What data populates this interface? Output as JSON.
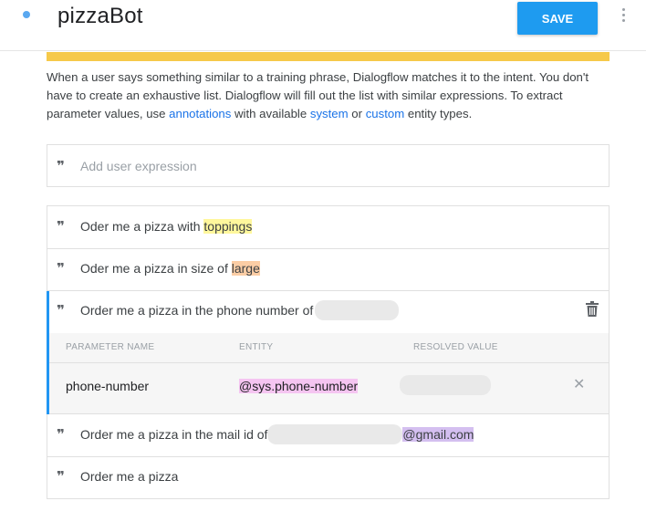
{
  "header": {
    "title": "pizzaBot",
    "save_label": "SAVE"
  },
  "description": {
    "part1": "When a user says something similar to a training phrase, Dialogflow matches it to the intent. You don't have to create an exhaustive list. Dialogflow will fill out the list with similar expressions. To extract parameter values, use ",
    "link_annotations": "annotations",
    "part2": " with available ",
    "link_system": "system",
    "part3": " or ",
    "link_custom": "custom",
    "part4": " entity types."
  },
  "add_expression": {
    "placeholder": "Add user expression"
  },
  "phrases": [
    {
      "prefix": "Oder me a pizza with ",
      "highlight": "toppings"
    },
    {
      "prefix": "Oder me a pizza in size of ",
      "highlight": "large"
    },
    {
      "prefix": "Order me a pizza in the phone number of"
    },
    {
      "prefix": "Order me a pizza in the mail id of",
      "highlight": "@gmail.com"
    },
    {
      "prefix": "Order me a pizza"
    }
  ],
  "parameter_table": {
    "headers": [
      "PARAMETER NAME",
      "ENTITY",
      "RESOLVED VALUE"
    ],
    "rows": [
      {
        "name": "phone-number",
        "entity": "@sys.phone-number"
      }
    ]
  },
  "colors": {
    "accent": "#1e9bf0",
    "banner": "#f6c94a",
    "active_bar": "#2196f3",
    "hl_yellow": "#fff79c",
    "hl_orange": "#fbcda5",
    "hl_pink": "#f5c5f1",
    "hl_purple": "#d4bff0"
  },
  "icons": [
    "status-dot-icon",
    "more-vert-icon",
    "quote-icon",
    "trash-icon",
    "close-icon"
  ]
}
